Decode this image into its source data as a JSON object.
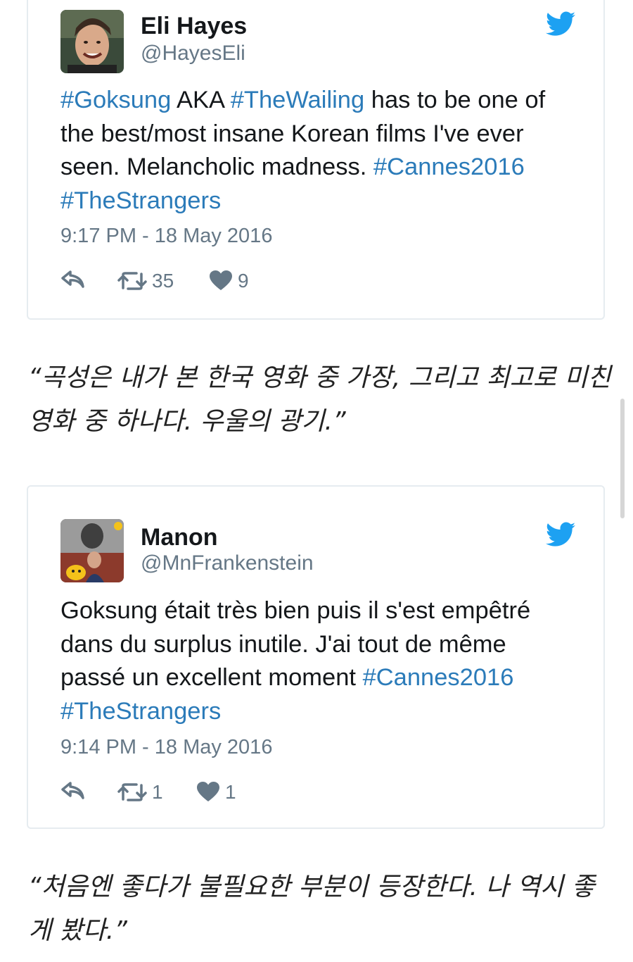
{
  "tweets": [
    {
      "name": "Eli Hayes",
      "handle": "@HayesEli",
      "text_segments": [
        {
          "text": "#Goksung",
          "hashtag": true
        },
        {
          "text": " AKA ",
          "hashtag": false
        },
        {
          "text": "#TheWailing",
          "hashtag": true
        },
        {
          "text": " has to be one of the best/most insane Korean films I've ever seen. Melancholic madness. ",
          "hashtag": false
        },
        {
          "text": "#Cannes2016",
          "hashtag": true
        },
        {
          "text": " ",
          "hashtag": false
        },
        {
          "text": "#TheStrangers",
          "hashtag": true
        }
      ],
      "timestamp": "9:17 PM - 18 May 2016",
      "retweets": "35",
      "likes": "9"
    },
    {
      "name": "Manon",
      "handle": "@MnFrankenstein",
      "text_segments": [
        {
          "text": "Goksung était très bien puis il s'est empêtré dans du surplus inutile. J'ai tout de même passé un excellent moment ",
          "hashtag": false
        },
        {
          "text": "#Cannes2016",
          "hashtag": true
        },
        {
          "text": " ",
          "hashtag": false
        },
        {
          "text": "#TheStrangers",
          "hashtag": true
        }
      ],
      "timestamp": "9:14 PM - 18 May 2016",
      "retweets": "1",
      "likes": "1"
    }
  ],
  "translations": [
    "“곡성은 내가 본 한국 영화 중 가장, 그리고 최고로 미친 영화 중 하나다. 우울의 광기.”",
    "“처음엔 좋다가 불필요한 부분이 등장한다. 나 역시 좋게 봤다.”"
  ],
  "colors": {
    "hashtag": "#2b7bb9",
    "twitter_bird": "#1da1f2",
    "meta_text": "#657786"
  },
  "icons": [
    "twitter-bird-icon",
    "reply-icon",
    "retweet-icon",
    "heart-icon"
  ]
}
